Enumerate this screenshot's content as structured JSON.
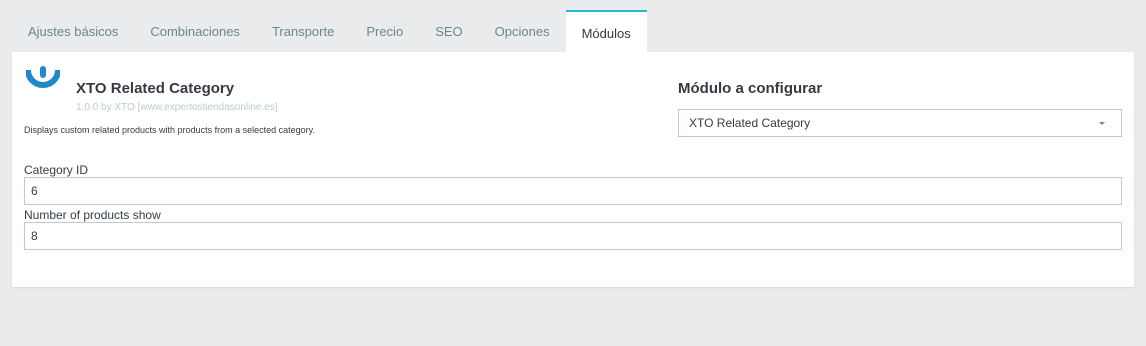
{
  "tabs": [
    {
      "label": "Ajustes básicos"
    },
    {
      "label": "Combinaciones"
    },
    {
      "label": "Transporte"
    },
    {
      "label": "Precio"
    },
    {
      "label": "SEO"
    },
    {
      "label": "Opciones"
    },
    {
      "label": "Módulos",
      "active": true
    }
  ],
  "module": {
    "logo_icon": "module-logo-icon",
    "name": "XTO Related Category",
    "version": "1.0.0 by XTO [www.expertostiendasonline.es]",
    "description": "Displays custom related products with products from a selected category."
  },
  "configure": {
    "title": "Módulo a configurar",
    "selected": "XTO Related Category"
  },
  "fields": {
    "category_id": {
      "label": "Category ID",
      "value": "6"
    },
    "products_show": {
      "label": "Number of products show",
      "value": "8"
    }
  },
  "colors": {
    "accent": "#25b9d7",
    "background": "#eaebed",
    "text": "#363a41",
    "muted": "#6c868e",
    "border": "#bbcdd2"
  }
}
